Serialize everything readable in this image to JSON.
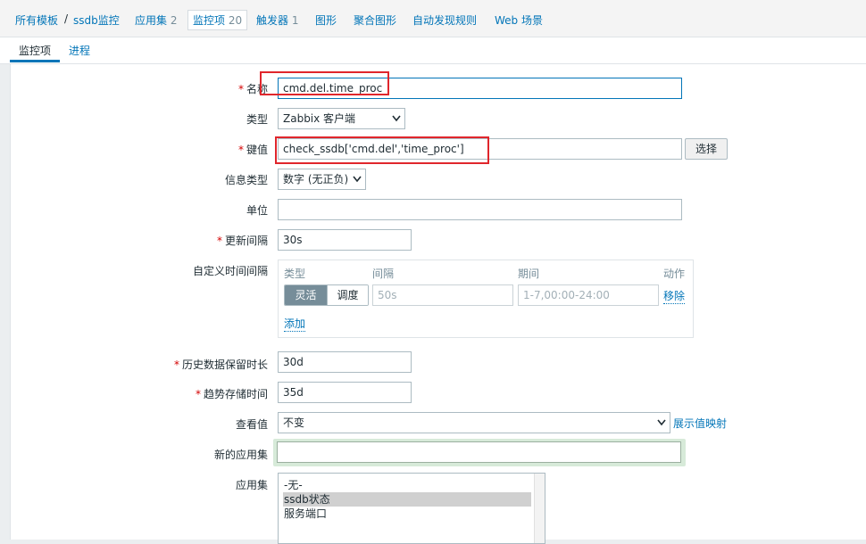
{
  "nav": {
    "all_templates": "所有模板",
    "sep": "/",
    "template": "ssdb监控",
    "applications": {
      "label": "应用集",
      "count": "2"
    },
    "items": {
      "label": "监控项",
      "count": "20"
    },
    "triggers": {
      "label": "触发器",
      "count": "1"
    },
    "graphs": "图形",
    "screens": "聚合图形",
    "discovery": "自动发现规则",
    "web": "Web 场景"
  },
  "tabs": [
    {
      "label": "监控项",
      "active": true
    },
    {
      "label": "进程",
      "active": false
    }
  ],
  "form": {
    "name": {
      "label": "名称",
      "required": true,
      "value": "cmd.del.time_proc"
    },
    "type": {
      "label": "类型",
      "value": "Zabbix 客户端"
    },
    "key": {
      "label": "键值",
      "required": true,
      "value": "check_ssdb['cmd.del','time_proc']",
      "select_button": "选择"
    },
    "info_type": {
      "label": "信息类型",
      "value": "数字 (无正负)"
    },
    "units": {
      "label": "单位",
      "value": ""
    },
    "update_interval": {
      "label": "更新间隔",
      "required": true,
      "value": "30s"
    },
    "custom_intervals": {
      "label": "自定义时间间隔",
      "headers": {
        "type": "类型",
        "interval": "间隔",
        "period": "期间",
        "action": "动作"
      },
      "row": {
        "flexible": "灵活",
        "scheduling": "调度",
        "interval_placeholder": "50s",
        "period_placeholder": "1-7,00:00-24:00",
        "remove": "移除"
      },
      "add": "添加"
    },
    "history": {
      "label": "历史数据保留时长",
      "required": true,
      "value": "30d"
    },
    "trends": {
      "label": "趋势存储时间",
      "required": true,
      "value": "35d"
    },
    "show_value": {
      "label": "查看值",
      "value": "不变",
      "mapping_link": "展示值映射"
    },
    "new_application": {
      "label": "新的应用集",
      "value": ""
    },
    "applications": {
      "label": "应用集",
      "options": [
        "-无-",
        "ssdb状态",
        "服务端口"
      ],
      "selected": "ssdb状态"
    }
  },
  "colors": {
    "link": "#0275b8",
    "required": "#d40000",
    "highlight_box": "#e0262c",
    "new_app_bg": "#d7ead9"
  },
  "icons": {
    "dropdown": "chevron-down-icon"
  }
}
